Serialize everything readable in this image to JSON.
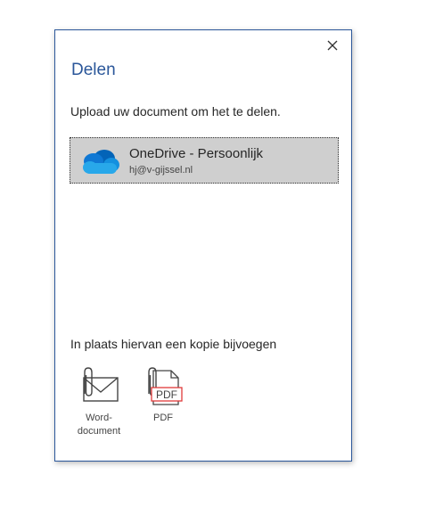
{
  "dialog": {
    "title": "Delen",
    "close_label": "×",
    "upload_prompt": "Upload uw document om het te delen.",
    "onedrive": {
      "name": "OneDrive - Persoonlijk",
      "account": "hj@v-gijssel.nl",
      "icon": "onedrive-cloud-icon"
    },
    "attach_prompt": "In plaats hiervan een kopie bijvoegen",
    "attach_options": [
      {
        "label": "Word-\ndocument",
        "icon": "word-attachment-icon"
      },
      {
        "label": "PDF",
        "icon": "pdf-attachment-icon",
        "icon_text": "PDF"
      }
    ]
  },
  "colors": {
    "accent": "#2b579a",
    "tile_bg": "#cfcfcf",
    "pdf_red": "#e03a3a",
    "cloud_light": "#28a8ea",
    "cloud_dark": "#0364b8"
  }
}
